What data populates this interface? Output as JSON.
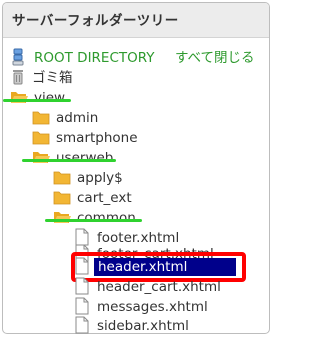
{
  "panel": {
    "title": "サーバーフォルダーツリー"
  },
  "tree": {
    "root_label": "ROOT DIRECTORY",
    "collapse_all": "すべて閉じる",
    "trash_label": "ゴミ箱",
    "items": [
      {
        "label": "view",
        "type": "folder-open"
      },
      {
        "label": "admin",
        "type": "folder"
      },
      {
        "label": "smartphone",
        "type": "folder"
      },
      {
        "label": "userweb",
        "type": "folder-open"
      },
      {
        "label": "apply$",
        "type": "folder"
      },
      {
        "label": "cart_ext",
        "type": "folder"
      },
      {
        "label": "common",
        "type": "folder-open"
      },
      {
        "label": "footer.xhtml",
        "type": "file"
      },
      {
        "label": "footer_cart.xhtml",
        "type": "file"
      },
      {
        "label": "header.xhtml",
        "type": "file",
        "selected": true
      },
      {
        "label": "header_cart.xhtml",
        "type": "file"
      },
      {
        "label": "messages.xhtml",
        "type": "file"
      },
      {
        "label": "sidebar.xhtml",
        "type": "file"
      }
    ]
  },
  "colors": {
    "selection_bg": "#00008b",
    "highlight_box": "#ff0000",
    "underline": "#2fd22f",
    "link_green": "#2e9a2e",
    "folder": "#f2b634"
  }
}
